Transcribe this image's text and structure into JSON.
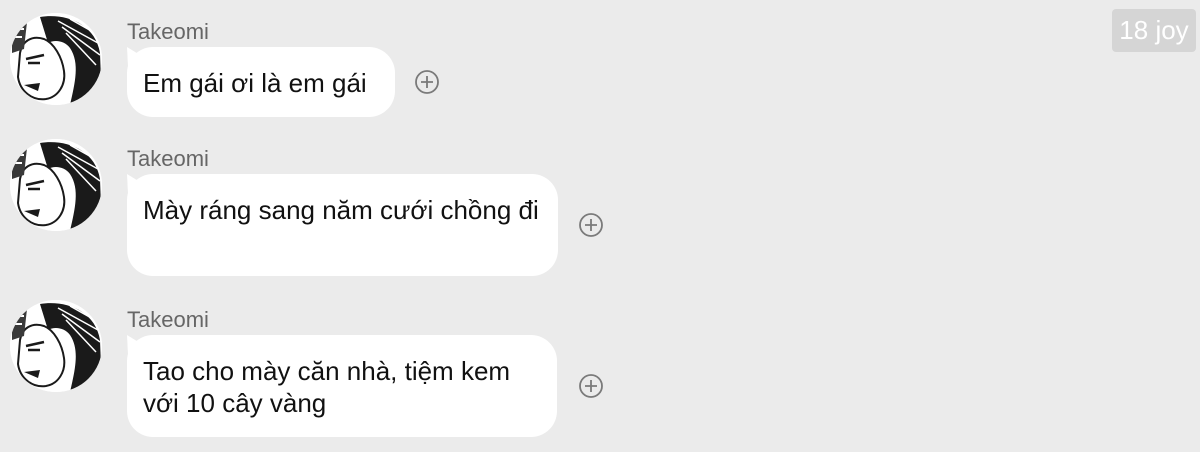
{
  "watermark": "18 joy",
  "messages": [
    {
      "sender": "Takeomi",
      "text": "Em gái ơi là em gái",
      "avatar_icon": "manga-portrait-avatar",
      "action_icon": "add-reaction-icon"
    },
    {
      "sender": "Takeomi",
      "text": "Mày ráng sang năm cưới chồng đi",
      "avatar_icon": "manga-portrait-avatar",
      "action_icon": "add-reaction-icon"
    },
    {
      "sender": "Takeomi",
      "text": "Tao cho mày căn nhà, tiệm kem với 10 cây vàng",
      "avatar_icon": "manga-portrait-avatar",
      "action_icon": "add-reaction-icon"
    }
  ],
  "colors": {
    "background": "#ebebeb",
    "bubble": "#ffffff",
    "sender": "#666666",
    "icon": "#7a7a7a"
  }
}
